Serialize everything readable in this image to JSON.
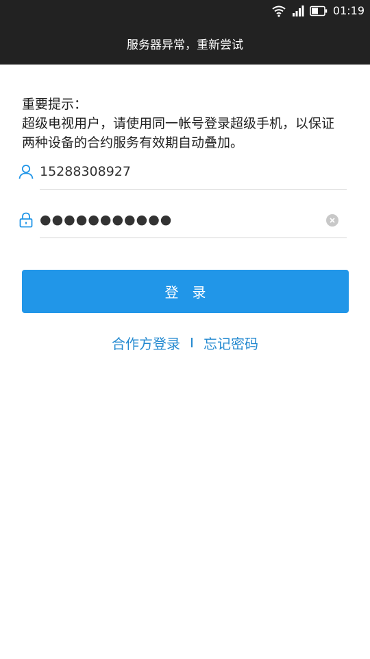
{
  "status_bar": {
    "time": "01:19",
    "icons": [
      "wifi-icon",
      "signal-icon",
      "battery-icon"
    ]
  },
  "banner": {
    "message": "服务器异常，重新尝试"
  },
  "notice": {
    "title": "重要提示：",
    "line1": "超级电视用户，请使用同一帐号登录超级手机，以保证",
    "line2": "两种设备的合约服务有效期自动叠加。"
  },
  "form": {
    "username_value": "15288308927",
    "password_value": "●●●●●●●●●●●",
    "username_icon": "user-icon",
    "password_icon": "lock-icon",
    "clear_icon": "clear-icon",
    "login_label": "登录"
  },
  "links": {
    "partner_login": "合作方登录",
    "forgot_password": "忘记密码"
  },
  "colors": {
    "accent": "#2196e8",
    "link": "#2389d0",
    "bar": "#222222"
  }
}
